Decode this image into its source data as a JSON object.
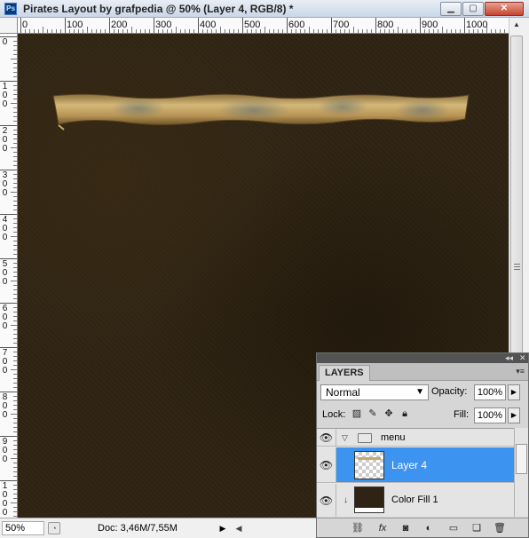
{
  "window": {
    "app_icon": "Ps",
    "title": "Pirates Layout by grafpedia @ 50% (Layer 4, RGB/8) *",
    "minimize_icon": "minimize-icon",
    "maximize_icon": "maximize-icon",
    "close_icon": "close-icon"
  },
  "ruler": {
    "top_labels": [
      "0",
      "100",
      "200",
      "300",
      "400",
      "500",
      "600",
      "700",
      "800",
      "900",
      "1000"
    ],
    "left_labels": [
      "0",
      "100",
      "200",
      "300",
      "400",
      "500",
      "600",
      "700",
      "800",
      "900",
      "1000"
    ]
  },
  "canvas": {
    "background_color": "#2f2413",
    "banner_color": "#c9a76a"
  },
  "statusbar": {
    "zoom": "50%",
    "doc_info": "Doc: 3,46M/7,55M"
  },
  "layers_panel": {
    "tab": "LAYERS",
    "blend_mode": "Normal",
    "opacity_label": "Opacity:",
    "opacity_value": "100%",
    "lock_label": "Lock:",
    "fill_label": "Fill:",
    "fill_value": "100%",
    "layers": [
      {
        "name": "menu",
        "type": "group",
        "visible": true,
        "expanded": true
      },
      {
        "name": "Layer 4",
        "type": "layer",
        "visible": true,
        "selected": true
      },
      {
        "name": "Color Fill 1",
        "type": "fill",
        "visible": true,
        "clipped": true
      }
    ],
    "selection_color": "#3c93f0"
  }
}
